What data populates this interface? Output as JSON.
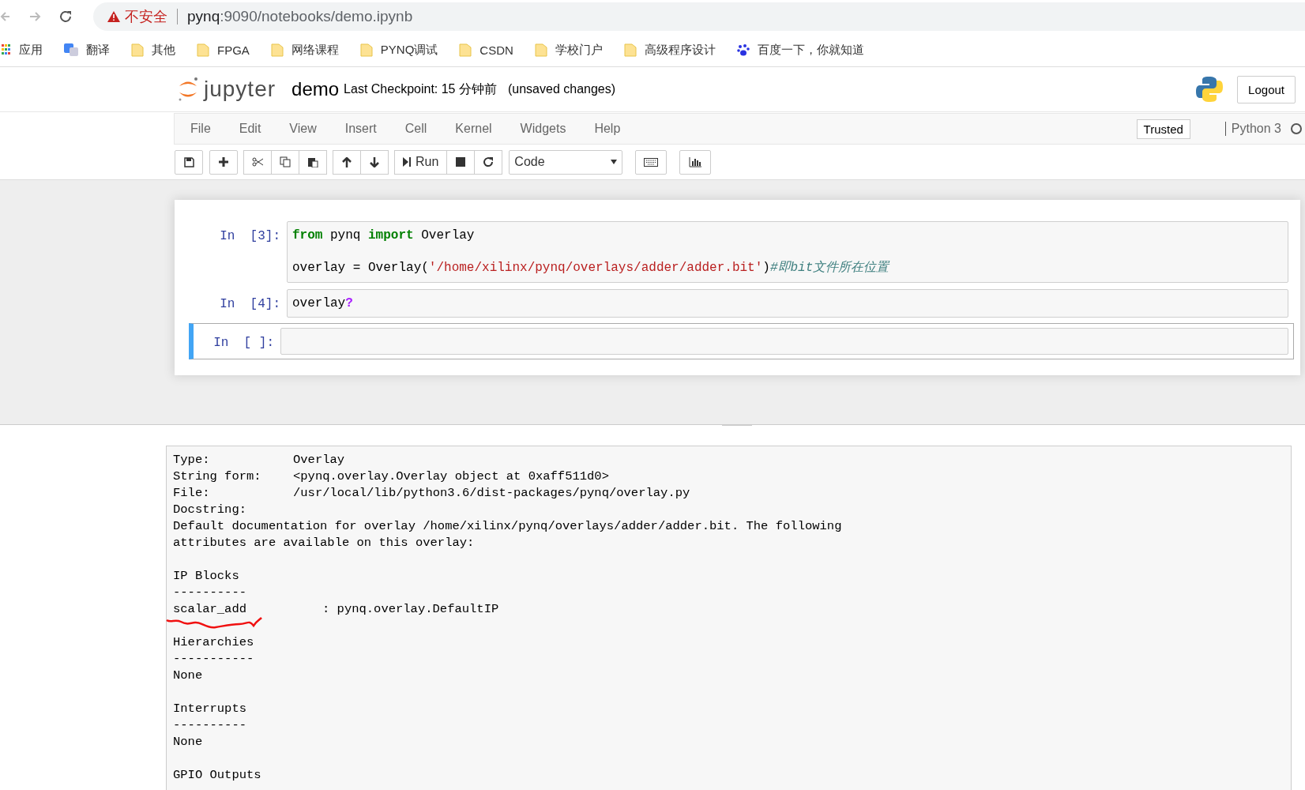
{
  "browser": {
    "security_label": "不安全",
    "url_host": "pynq",
    "url_rest": ":9090/notebooks/demo.ipynb",
    "bookmarks": [
      {
        "kind": "apps",
        "label": "应用"
      },
      {
        "kind": "translate",
        "label": "翻译"
      },
      {
        "kind": "folder",
        "label": "其他"
      },
      {
        "kind": "folder",
        "label": "FPGA"
      },
      {
        "kind": "folder",
        "label": "网络课程"
      },
      {
        "kind": "folder",
        "label": "PYNQ调试"
      },
      {
        "kind": "folder",
        "label": "CSDN"
      },
      {
        "kind": "folder",
        "label": "学校门户"
      },
      {
        "kind": "folder",
        "label": "高级程序设计"
      },
      {
        "kind": "paw",
        "label": "百度一下，你就知道"
      }
    ]
  },
  "header": {
    "logo_text": "jupyter",
    "notebook_name": "demo",
    "checkpoint": "Last Checkpoint: 15 分钟前",
    "autosave_status": "(unsaved changes)",
    "logout": "Logout"
  },
  "menubar": {
    "items": [
      "File",
      "Edit",
      "View",
      "Insert",
      "Cell",
      "Kernel",
      "Widgets",
      "Help"
    ],
    "trusted": "Trusted",
    "kernel_name": "Python 3",
    "kernel_busy": false
  },
  "toolbar": {
    "run_label": "Run",
    "cell_type": "Code"
  },
  "cells": [
    {
      "prompt": "In  [3]:",
      "selected": false,
      "lines": [
        {
          "kind": "code",
          "tokens": [
            {
              "kind": "keyword",
              "text": "from"
            },
            {
              "kind": "plain",
              "text": " pynq "
            },
            {
              "kind": "keyword",
              "text": "import"
            },
            {
              "kind": "plain",
              "text": " Overlay"
            }
          ]
        },
        {
          "kind": "blank"
        },
        {
          "kind": "code",
          "tokens": [
            {
              "kind": "plain",
              "text": "overlay = Overlay("
            },
            {
              "kind": "string",
              "text": "'/home/xilinx/pynq/overlays/adder/adder.bit'"
            },
            {
              "kind": "plain",
              "text": ")"
            },
            {
              "kind": "comment",
              "text": "#即bit文件所在位置"
            }
          ]
        }
      ]
    },
    {
      "prompt": "In  [4]:",
      "selected": false,
      "lines": [
        {
          "kind": "code",
          "tokens": [
            {
              "kind": "plain",
              "text": "overlay"
            },
            {
              "kind": "operator",
              "text": "?"
            }
          ]
        }
      ]
    },
    {
      "prompt": "In  [ ]:",
      "selected": true
    }
  ],
  "pager": {
    "lines": [
      {
        "kind": "field",
        "label": "Type:",
        "value": "Overlay"
      },
      {
        "kind": "field",
        "label": "String form:",
        "value": "<pynq.overlay.Overlay object at 0xaff511d0>"
      },
      {
        "kind": "field",
        "label": "File:",
        "value": "/usr/local/lib/python3.6/dist-packages/pynq/overlay.py"
      },
      {
        "kind": "text",
        "text": "Docstring:"
      },
      {
        "kind": "text",
        "text": "Default documentation for overlay /home/xilinx/pynq/overlays/adder/adder.bit. The following"
      },
      {
        "kind": "text",
        "text": "attributes are available on this overlay:"
      },
      {
        "kind": "blank"
      },
      {
        "kind": "text",
        "text": "IP Blocks"
      },
      {
        "kind": "text",
        "text": "----------"
      },
      {
        "kind": "entry",
        "label": "scalar_add",
        "value": ": pynq.overlay.DefaultIP",
        "underlined": true
      },
      {
        "kind": "blank"
      },
      {
        "kind": "text",
        "text": "Hierarchies"
      },
      {
        "kind": "text",
        "text": "-----------"
      },
      {
        "kind": "text",
        "text": "None"
      },
      {
        "kind": "blank"
      },
      {
        "kind": "text",
        "text": "Interrupts"
      },
      {
        "kind": "text",
        "text": "----------"
      },
      {
        "kind": "text",
        "text": "None"
      },
      {
        "kind": "blank"
      },
      {
        "kind": "text",
        "text": "GPIO Outputs"
      }
    ]
  }
}
